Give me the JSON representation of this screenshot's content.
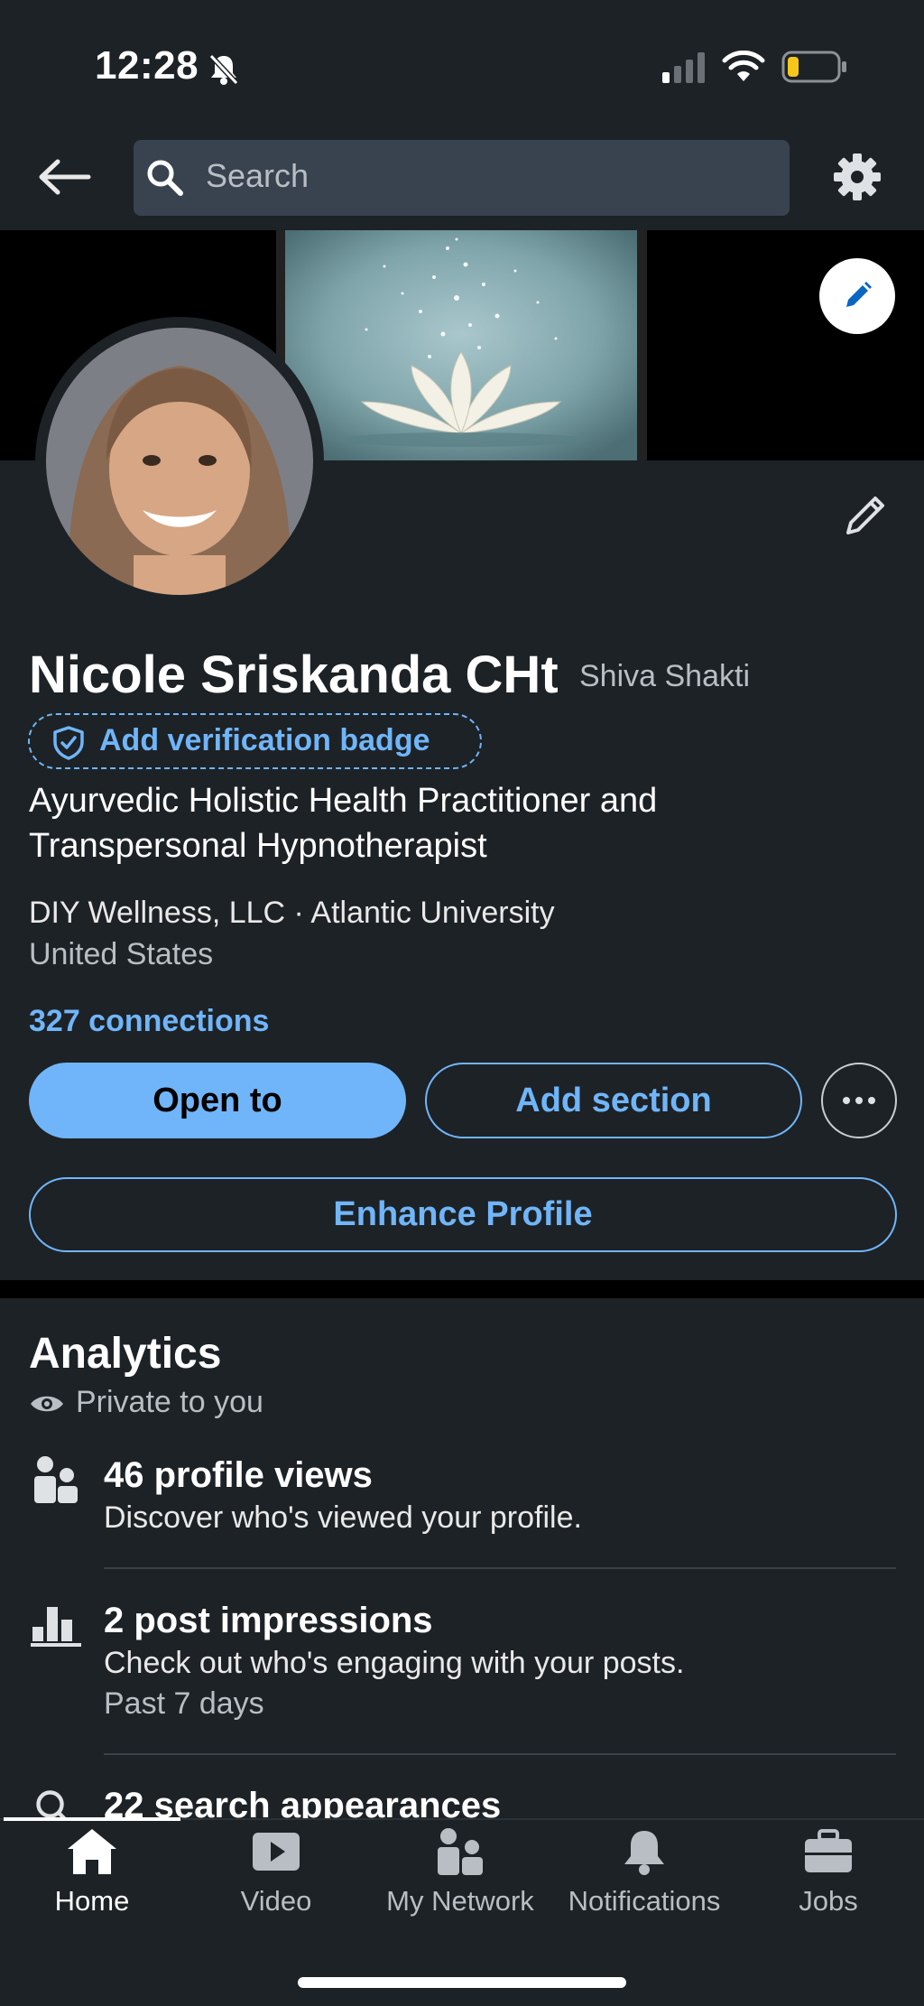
{
  "status_bar": {
    "time": "12:28"
  },
  "nav": {
    "search_placeholder": "Search"
  },
  "profile": {
    "name": "Nicole Sriskanda CHt",
    "pronoun": "Shiva Shakti",
    "verification_badge": "Add verification badge",
    "headline": "Ayurvedic Holistic Health Practitioner and Transpersonal Hypnotherapist",
    "company": "DIY Wellness, LLC · Atlantic University",
    "location": "United States",
    "connections": "327 connections",
    "buttons": {
      "open_to": "Open to",
      "add_section": "Add section",
      "enhance_profile": "Enhance Profile"
    }
  },
  "analytics": {
    "title": "Analytics",
    "visibility": "Private to you",
    "items": [
      {
        "title": "46 profile views",
        "subtitle": "Discover who's viewed your profile.",
        "meta": "",
        "icon": "people-icon"
      },
      {
        "title": "2 post impressions",
        "subtitle": "Check out who's engaging with your posts.",
        "meta": "Past 7 days",
        "icon": "bar-chart-icon"
      },
      {
        "title": "22 search appearances",
        "subtitle": "",
        "meta": "",
        "icon": "search-icon"
      }
    ]
  },
  "tabs": [
    {
      "label": "Home",
      "icon": "home-icon",
      "active": true
    },
    {
      "label": "Video",
      "icon": "video-icon",
      "active": false
    },
    {
      "label": "My Network",
      "icon": "network-icon",
      "active": false
    },
    {
      "label": "Notifications",
      "icon": "bell-icon",
      "active": false
    },
    {
      "label": "Jobs",
      "icon": "briefcase-icon",
      "active": false
    }
  ],
  "colors": {
    "background": "#1d2226",
    "accent": "#70b5f9",
    "search_bg": "#38434f",
    "battery_low": "#f5c71a"
  }
}
